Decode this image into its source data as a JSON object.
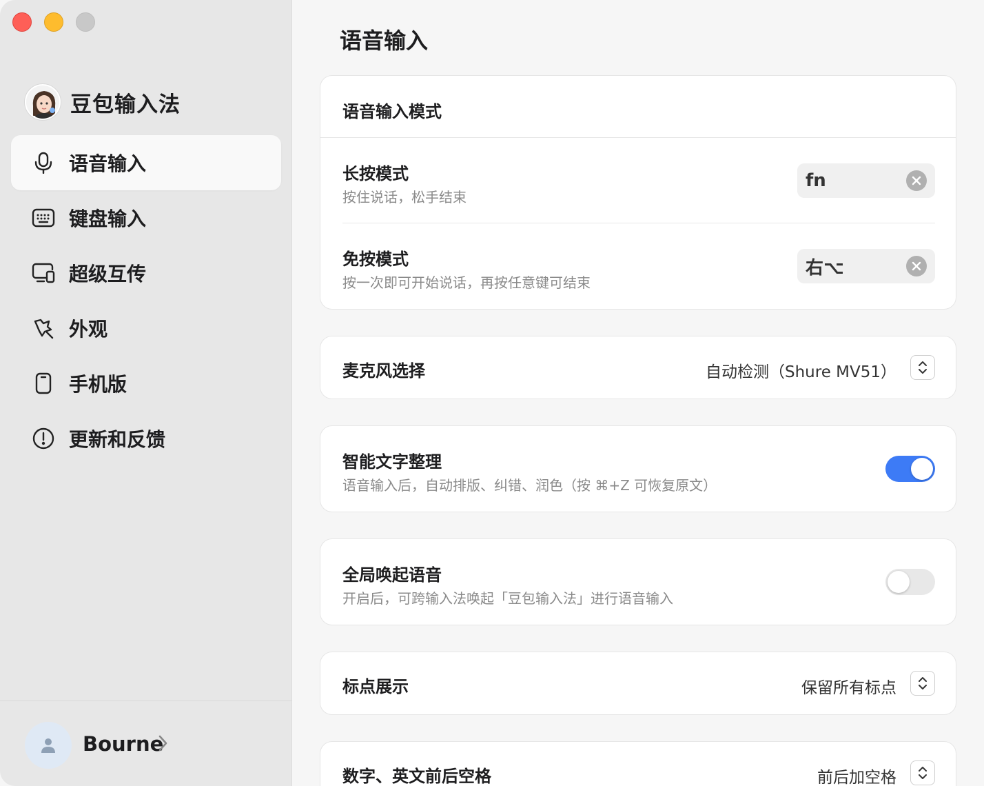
{
  "sidebar": {
    "app_name": "豆包输入法",
    "items": [
      {
        "label": "语音输入",
        "icon": "microphone-icon",
        "active": true
      },
      {
        "label": "键盘输入",
        "icon": "keyboard-icon",
        "active": false
      },
      {
        "label": "超级互传",
        "icon": "devices-icon",
        "active": false
      },
      {
        "label": "外观",
        "icon": "brush-icon",
        "active": false
      },
      {
        "label": "手机版",
        "icon": "phone-icon",
        "active": false
      },
      {
        "label": "更新和反馈",
        "icon": "info-icon",
        "active": false
      }
    ],
    "user": {
      "name": "Bourne"
    }
  },
  "main": {
    "title": "语音输入",
    "voice_mode": {
      "title": "语音输入模式",
      "long_press": {
        "title": "长按模式",
        "desc": "按住说话，松手结束",
        "key": "fn"
      },
      "free_press": {
        "title": "免按模式",
        "desc": "按一次即可开始说话，再按任意键可结束",
        "key": "右⌥"
      }
    },
    "microphone": {
      "title": "麦克风选择",
      "value": "自动检测（Shure MV51）"
    },
    "smart_text": {
      "title": "智能文字整理",
      "desc": "语音输入后，自动排版、纠错、润色（按 ⌘+Z 可恢复原文）",
      "enabled": true
    },
    "global_voice": {
      "title": "全局唤起语音",
      "desc": "开启后，可跨输入法唤起「豆包输入法」进行语音输入",
      "enabled": false
    },
    "punctuation": {
      "title": "标点展示",
      "value": "保留所有标点"
    },
    "spacing": {
      "title": "数字、英文前后空格",
      "value": "前后加空格"
    }
  },
  "colors": {
    "accent": "#3d7bf6",
    "sidebar_bg": "#e7e7e7",
    "content_bg": "#f6f6f6"
  }
}
